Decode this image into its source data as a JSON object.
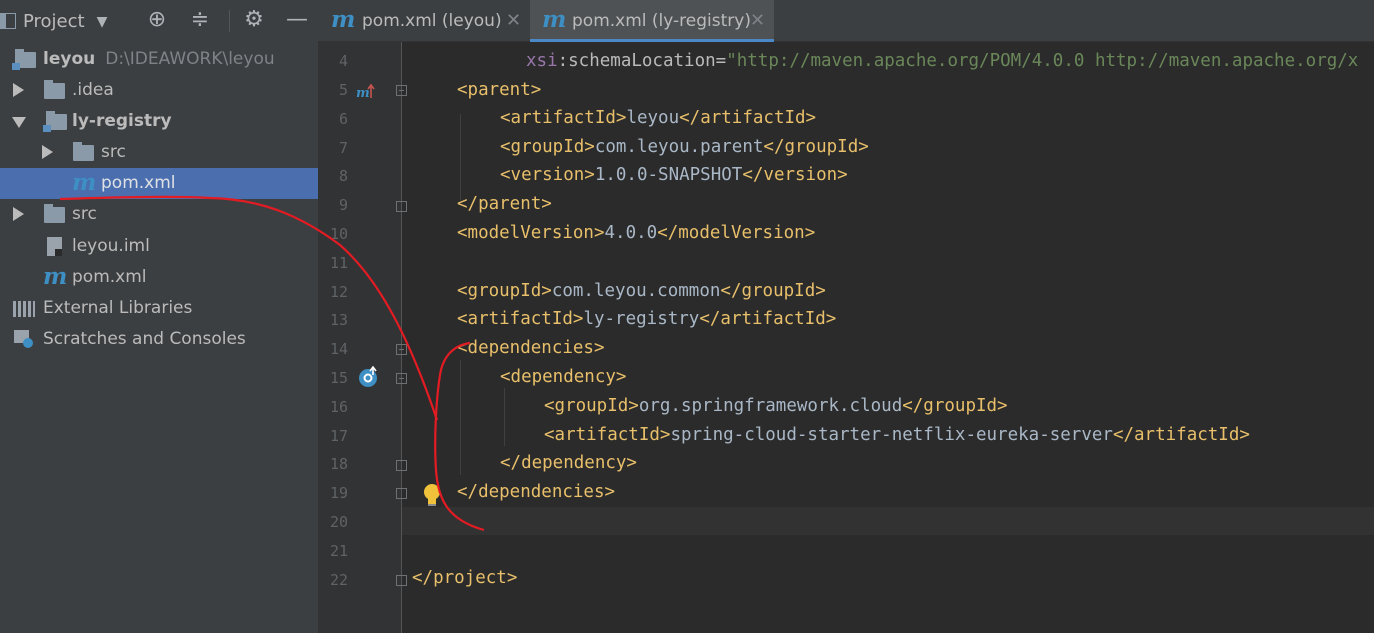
{
  "project_panel": {
    "title": "Project",
    "tree": [
      {
        "label": "leyou",
        "path": "D:\\IDEAWORK\\leyou",
        "kind": "module-root"
      },
      {
        "label": ".idea",
        "kind": "folder"
      },
      {
        "label": "ly-registry",
        "kind": "module"
      },
      {
        "label": "src",
        "kind": "folder"
      },
      {
        "label": "pom.xml",
        "kind": "maven-file",
        "selected": true
      },
      {
        "label": "src",
        "kind": "folder"
      },
      {
        "label": "leyou.iml",
        "kind": "file"
      },
      {
        "label": "pom.xml",
        "kind": "maven-file"
      },
      {
        "label": "External Libraries",
        "kind": "libraries"
      },
      {
        "label": "Scratches and Consoles",
        "kind": "scratches"
      }
    ]
  },
  "tabs": [
    {
      "label": "pom.xml (leyou)",
      "active": false
    },
    {
      "label": "pom.xml (ly-registry)",
      "active": true
    }
  ],
  "editor": {
    "line_numbers": [
      "4",
      "5",
      "6",
      "7",
      "8",
      "9",
      "10",
      "11",
      "12",
      "13",
      "14",
      "15",
      "16",
      "17",
      "18",
      "19",
      "20",
      "21",
      "22"
    ],
    "lines": [
      {
        "no": "4",
        "ns": "xsi",
        "attr": ":schemaLocation=",
        "value": "\"http://maven.apache.org/POM/4.0.0 http://maven.apache.org/x"
      },
      {
        "no": "5",
        "text": "<parent>"
      },
      {
        "no": "6",
        "open": "<artifactId>",
        "content": "leyou",
        "close": "</artifactId>"
      },
      {
        "no": "7",
        "open": "<groupId>",
        "content": "com.leyou.parent",
        "close": "</groupId>"
      },
      {
        "no": "8",
        "open": "<version>",
        "content": "1.0.0-SNAPSHOT",
        "close": "</version>"
      },
      {
        "no": "9",
        "text": "</parent>"
      },
      {
        "no": "10",
        "open": "<modelVersion>",
        "content": "4.0.0",
        "close": "</modelVersion>"
      },
      {
        "no": "11",
        "text": ""
      },
      {
        "no": "12",
        "open": "<groupId>",
        "content": "com.leyou.common",
        "close": "</groupId>"
      },
      {
        "no": "13",
        "open": "<artifactId>",
        "content": "ly-registry",
        "close": "</artifactId>"
      },
      {
        "no": "14",
        "text": "<dependencies>"
      },
      {
        "no": "15",
        "text": "<dependency>"
      },
      {
        "no": "16",
        "open": "<groupId>",
        "content": "org.springframework.cloud",
        "close": "</groupId>"
      },
      {
        "no": "17",
        "open": "<artifactId>",
        "content": "spring-cloud-starter-netflix-eureka-server",
        "close": "</artifactId>"
      },
      {
        "no": "18",
        "text": "</dependency>"
      },
      {
        "no": "19",
        "text": "</dependencies>"
      },
      {
        "no": "20",
        "text": ""
      },
      {
        "no": "21",
        "text": ""
      },
      {
        "no": "22",
        "text": "</project>"
      }
    ]
  },
  "colors": {
    "tag": "#e8bf6a",
    "text": "#a9b7c6",
    "string": "#6a8759",
    "namespace": "#9876aa",
    "selection": "#4b6eaf",
    "annotation": "#e31b23"
  }
}
